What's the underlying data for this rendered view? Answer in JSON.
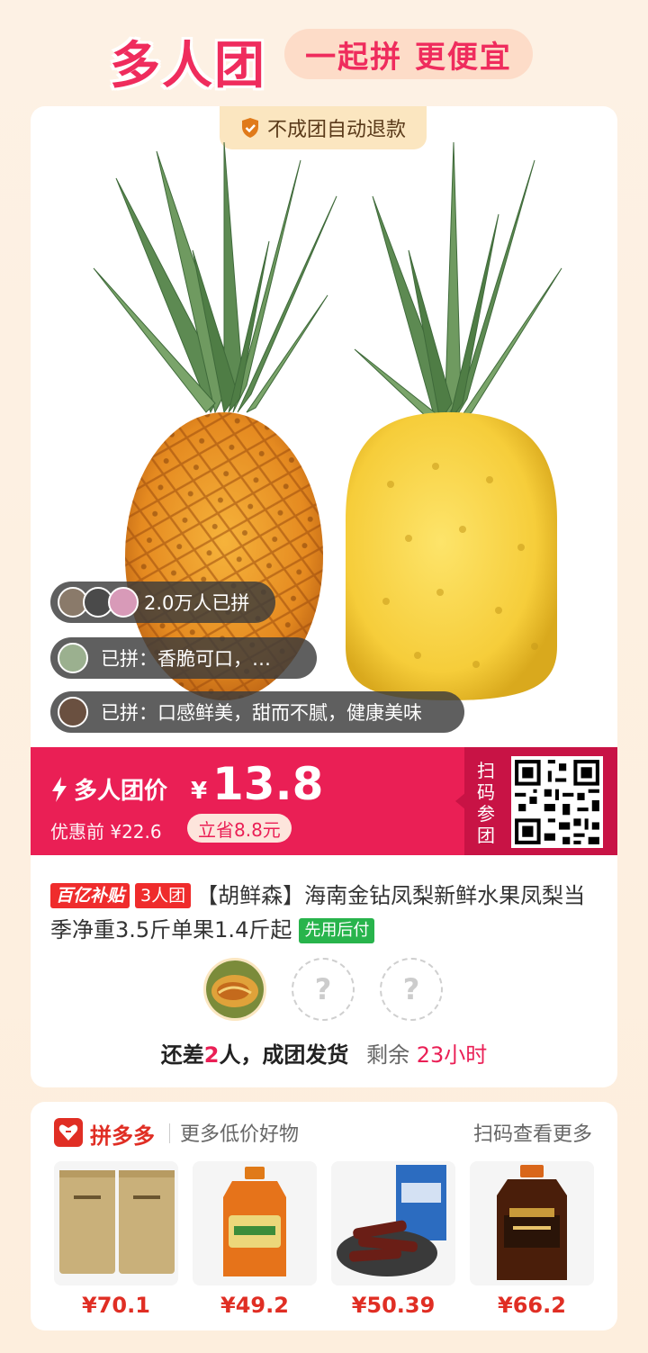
{
  "header": {
    "logo_title": "多人团",
    "slogan": "一起拼 更便宜"
  },
  "card": {
    "refund_badge": "不成团自动退款",
    "buyers": [
      {
        "text": "2.0万人已拼"
      },
      {
        "text": "已拼：香脆可口，…"
      },
      {
        "text": "已拼：口感鲜美，甜而不腻，健康美味"
      }
    ],
    "price": {
      "label": "多人团价",
      "currency": "¥",
      "amount": "13.8",
      "original": "优惠前 ¥22.6",
      "savings": "立省8.8元",
      "scan_label": "扫码参团"
    },
    "title": {
      "tag_subsidy": "百亿补贴",
      "tag_group": "3人团",
      "text": "【胡鲜森】海南金钻凤梨新鲜水果凤梨当季净重3.5斤单果1.4斤起",
      "tag_paylater": "先用后付"
    },
    "members": {
      "empty_placeholder": "?"
    },
    "status": {
      "prefix": "还差",
      "count": "2",
      "suffix": "人，成团发货",
      "remaining_label": "剩余",
      "remaining_time": "23小时"
    }
  },
  "more": {
    "brand": "拼多多",
    "subtitle": "更多低价好物",
    "scan_more": "扫码查看更多",
    "products": [
      {
        "price": "¥70.1"
      },
      {
        "price": "¥49.2"
      },
      {
        "price": "¥50.39"
      },
      {
        "price": "¥66.2"
      }
    ]
  },
  "colors": {
    "accent": "#ea1f55",
    "brand_red": "#e02e24",
    "badge_bg": "#fbe6c0",
    "paylater_green": "#28b44c"
  }
}
